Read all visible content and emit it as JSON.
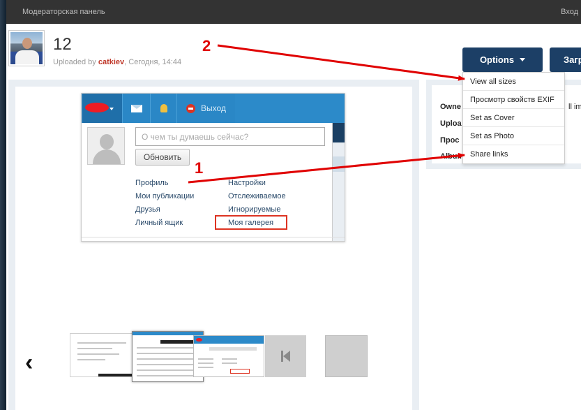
{
  "topbar": {
    "left_label": "Модераторская панель",
    "right_label": "Вход"
  },
  "photo": {
    "title": "12",
    "uploaded_prefix": "Uploaded by",
    "uploader": "catkiev",
    "uploaded_when": ", Сегодня, 14:44"
  },
  "buttons": {
    "options_label": "Options",
    "upload_label": "Загрузить"
  },
  "options_menu": [
    {
      "label": "View all sizes"
    },
    {
      "label": "Просмотр свойств EXIF"
    },
    {
      "label": "Set as Cover"
    },
    {
      "label": "Set as Photo"
    },
    {
      "label": "Share links"
    }
  ],
  "info_panel": {
    "owner_label": "Owne",
    "upload_label": "Uploa",
    "views_label": "Прос",
    "album_label": "Album",
    "extra_text": "ll ima"
  },
  "embedded_screenshot": {
    "exit_label": "Выход",
    "status_placeholder": "О чем ты думаешь сейчас?",
    "update_button": "Обновить",
    "menu_left": [
      "Профиль",
      "Мои публикации",
      "Друзья",
      "Личный ящик"
    ],
    "menu_right": [
      "Настройки",
      "Отслеживаемое",
      "Игнорируемые",
      "Моя галерея"
    ]
  },
  "annotations": {
    "marker_1": "1",
    "marker_2": "2",
    "color": "#e00000"
  },
  "carousel": {
    "prev_icon": "chevron-left-icon",
    "skip_icon": "skip-to-start-icon"
  }
}
